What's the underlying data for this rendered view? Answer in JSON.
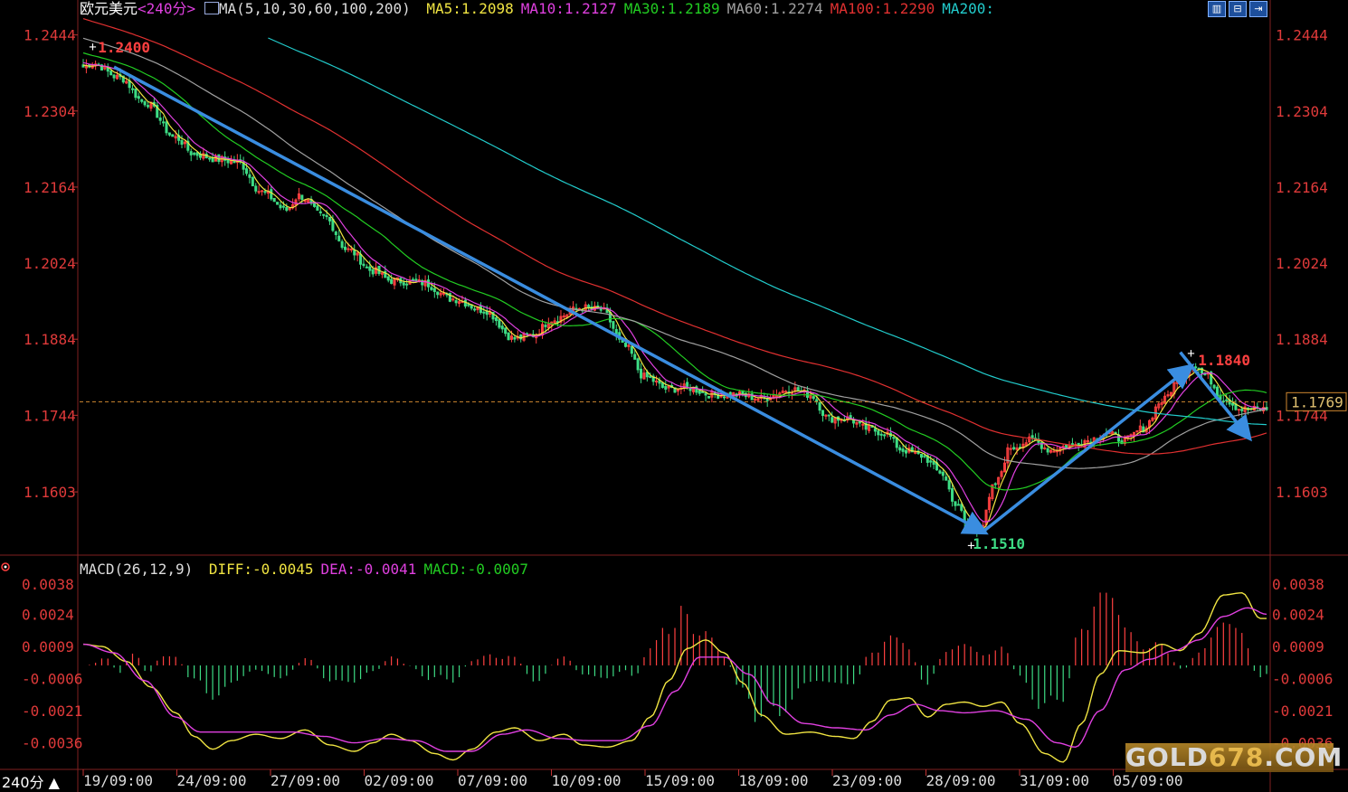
{
  "header": {
    "instrument": "欧元美元",
    "period": "<240分>",
    "ma_label": "MA(5,10,30,60,100,200)",
    "ma_values": [
      {
        "name": "MA5",
        "value": "1.2098",
        "color": "#f0e442"
      },
      {
        "name": "MA10",
        "value": "1.2127",
        "color": "#e040e0"
      },
      {
        "name": "MA30",
        "value": "1.2189",
        "color": "#22cc22"
      },
      {
        "name": "MA60",
        "value": "1.2274",
        "color": "#a0a0a0"
      },
      {
        "name": "MA100",
        "value": "1.2290",
        "color": "#e03030"
      },
      {
        "name": "MA200",
        "value": "",
        "color": "#22cccc"
      }
    ]
  },
  "macd_header": {
    "label": "MACD(26,12,9)",
    "values": [
      {
        "name": "DIFF",
        "value": "-0.0045",
        "color": "#f0e442"
      },
      {
        "name": "DEA",
        "value": "-0.0041",
        "color": "#e040e0"
      },
      {
        "name": "MACD",
        "value": "-0.0007",
        "color": "#22cc22"
      }
    ]
  },
  "toolbar_icons": [
    "chart-icon",
    "fold-icon",
    "exit-icon"
  ],
  "period_tag": "240分 ▲",
  "watermark": {
    "text": "GOLD",
    "number": "678",
    ".com": ".COM"
  },
  "colors": {
    "up": "#ff4040",
    "down": "#3ddc84",
    "axis": "#e03a3a",
    "grid": "#222",
    "arrow": "#3a8de0"
  },
  "chart_data": [
    {
      "type": "candlestick",
      "name": "EURUSD 240min",
      "ylim": [
        1.149,
        1.2475
      ],
      "yticks": [
        1.2444,
        1.2304,
        1.2164,
        1.2024,
        1.1884,
        1.1744,
        1.1603
      ],
      "xticks": [
        "19/09:00",
        "24/09:00",
        "27/09:00",
        "02/09:00",
        "07/09:00",
        "10/09:00",
        "15/09:00",
        "18/09:00",
        "23/09:00",
        "28/09:00",
        "31/09:00",
        "05/09:00"
      ],
      "n_bars": 250,
      "close_anchors": [
        [
          0,
          1.2385
        ],
        [
          3,
          1.2392
        ],
        [
          12,
          1.2365
        ],
        [
          20,
          1.232
        ],
        [
          30,
          1.2255
        ],
        [
          36,
          1.2225
        ],
        [
          44,
          1.2215
        ],
        [
          50,
          1.221
        ],
        [
          58,
          1.2155
        ],
        [
          66,
          1.2122
        ],
        [
          70,
          1.2148
        ],
        [
          78,
          1.211
        ],
        [
          86,
          1.2048
        ],
        [
          94,
          1.201
        ],
        [
          100,
          1.1992
        ],
        [
          110,
          1.1988
        ],
        [
          120,
          1.1958
        ],
        [
          130,
          1.1938
        ],
        [
          140,
          1.1885
        ],
        [
          146,
          1.1892
        ],
        [
          152,
          1.192
        ],
        [
          162,
          1.1942
        ],
        [
          168,
          1.1938
        ],
        [
          176,
          1.187
        ],
        [
          182,
          1.1815
        ],
        [
          190,
          1.1792
        ],
        [
          196,
          1.1795
        ],
        [
          204,
          1.1782
        ],
        [
          212,
          1.1782
        ],
        [
          220,
          1.1775
        ],
        [
          230,
          1.1792
        ],
        [
          236,
          1.1782
        ],
        [
          242,
          1.1738
        ],
        [
          248,
          1.1738
        ],
        [
          254,
          1.172
        ],
        [
          260,
          1.1712
        ],
        [
          266,
          1.168
        ],
        [
          272,
          1.167
        ],
        [
          278,
          1.164
        ],
        [
          284,
          1.1575
        ],
        [
          287,
          1.1538
        ],
        [
          291,
          1.1535
        ],
        [
          296,
          1.1618
        ],
        [
          301,
          1.1685
        ],
        [
          308,
          1.1698
        ],
        [
          314,
          1.168
        ],
        [
          320,
          1.1688
        ],
        [
          326,
          1.1698
        ],
        [
          332,
          1.171
        ],
        [
          338,
          1.1698
        ],
        [
          344,
          1.172
        ],
        [
          350,
          1.177
        ],
        [
          356,
          1.1812
        ],
        [
          360,
          1.1838
        ],
        [
          364,
          1.1818
        ],
        [
          370,
          1.1775
        ],
        [
          376,
          1.1755
        ]
      ],
      "high_label": "1.2400",
      "low_label": "1.1510",
      "swing_label": "1.1840",
      "last_price": "1.1769",
      "last_value": 1.1769,
      "moving_averages": [
        {
          "name": "MA5",
          "period": 5,
          "color": "#f0e442"
        },
        {
          "name": "MA10",
          "period": 10,
          "color": "#e040e0"
        },
        {
          "name": "MA30",
          "period": 30,
          "color": "#22cc22"
        },
        {
          "name": "MA60",
          "period": 60,
          "color": "#a0a0a0"
        },
        {
          "name": "MA100",
          "period": 100,
          "color": "#e03030"
        },
        {
          "name": "MA200",
          "period": 200,
          "color": "#22cccc"
        }
      ],
      "trend_arrows": [
        {
          "from": [
            10,
            1.2385
          ],
          "to": [
            292,
            1.153
          ]
        },
        {
          "from": [
            292,
            1.153
          ],
          "to": [
            359,
            1.1832
          ]
        },
        {
          "from": [
            356,
            1.186
          ],
          "to": [
            378,
            1.1705
          ]
        }
      ]
    },
    {
      "type": "macd",
      "ylim": [
        -0.0048,
        0.0044
      ],
      "yticks": [
        0.0038,
        0.0024,
        0.0009,
        -0.0006,
        -0.0021,
        -0.0036
      ],
      "diff": [
        [
          0,
          0.001
        ],
        [
          6,
          0.0009
        ],
        [
          14,
          0.0002
        ],
        [
          22,
          -0.001
        ],
        [
          30,
          -0.0022
        ],
        [
          36,
          -0.0033
        ],
        [
          42,
          -0.0039
        ],
        [
          48,
          -0.0035
        ],
        [
          56,
          -0.0032
        ],
        [
          64,
          -0.0034
        ],
        [
          72,
          -0.003
        ],
        [
          80,
          -0.0037
        ],
        [
          88,
          -0.004
        ],
        [
          94,
          -0.0036
        ],
        [
          100,
          -0.0032
        ],
        [
          106,
          -0.0035
        ],
        [
          114,
          -0.0041
        ],
        [
          120,
          -0.0044
        ],
        [
          126,
          -0.0039
        ],
        [
          134,
          -0.0031
        ],
        [
          140,
          -0.0029
        ],
        [
          148,
          -0.0035
        ],
        [
          156,
          -0.0032
        ],
        [
          162,
          -0.0037
        ],
        [
          170,
          -0.0038
        ],
        [
          178,
          -0.0035
        ],
        [
          184,
          -0.0024
        ],
        [
          190,
          -0.0007
        ],
        [
          196,
          0.0008
        ],
        [
          202,
          0.0012
        ],
        [
          208,
          0.0006
        ],
        [
          214,
          -0.0008
        ],
        [
          220,
          -0.0023
        ],
        [
          228,
          -0.0032
        ],
        [
          236,
          -0.0031
        ],
        [
          244,
          -0.0033
        ],
        [
          250,
          -0.0034
        ],
        [
          256,
          -0.0026
        ],
        [
          262,
          -0.0016
        ],
        [
          268,
          -0.0015
        ],
        [
          274,
          -0.0024
        ],
        [
          280,
          -0.0018
        ],
        [
          286,
          -0.0017
        ],
        [
          292,
          -0.0019
        ],
        [
          298,
          -0.0017
        ],
        [
          304,
          -0.0027
        ],
        [
          312,
          -0.0041
        ],
        [
          318,
          -0.0045
        ],
        [
          324,
          -0.0027
        ],
        [
          330,
          -0.0004
        ],
        [
          336,
          0.0007
        ],
        [
          344,
          0.0006
        ],
        [
          350,
          0.001
        ],
        [
          356,
          0.0007
        ],
        [
          362,
          0.0015
        ],
        [
          370,
          0.0033
        ],
        [
          376,
          0.0034
        ],
        [
          382,
          0.0022
        ]
      ],
      "dea": [
        [
          0,
          0.001
        ],
        [
          10,
          0.0006
        ],
        [
          20,
          -0.0007
        ],
        [
          30,
          -0.0024
        ],
        [
          38,
          -0.0031
        ],
        [
          48,
          -0.0031
        ],
        [
          58,
          -0.0031
        ],
        [
          68,
          -0.0031
        ],
        [
          78,
          -0.0033
        ],
        [
          88,
          -0.0036
        ],
        [
          98,
          -0.0034
        ],
        [
          108,
          -0.0035
        ],
        [
          118,
          -0.004
        ],
        [
          126,
          -0.004
        ],
        [
          136,
          -0.0032
        ],
        [
          144,
          -0.003
        ],
        [
          154,
          -0.0034
        ],
        [
          164,
          -0.0035
        ],
        [
          174,
          -0.0035
        ],
        [
          184,
          -0.0028
        ],
        [
          192,
          -0.0012
        ],
        [
          200,
          0.0004
        ],
        [
          208,
          0.0004
        ],
        [
          216,
          -0.0004
        ],
        [
          224,
          -0.0018
        ],
        [
          234,
          -0.0027
        ],
        [
          244,
          -0.0029
        ],
        [
          254,
          -0.003
        ],
        [
          262,
          -0.0023
        ],
        [
          270,
          -0.0018
        ],
        [
          278,
          -0.0021
        ],
        [
          286,
          -0.0022
        ],
        [
          296,
          -0.0021
        ],
        [
          306,
          -0.0025
        ],
        [
          316,
          -0.0036
        ],
        [
          322,
          -0.0038
        ],
        [
          330,
          -0.0021
        ],
        [
          338,
          -0.0002
        ],
        [
          346,
          0.0003
        ],
        [
          354,
          0.0007
        ],
        [
          362,
          0.0012
        ],
        [
          370,
          0.0023
        ],
        [
          378,
          0.0027
        ],
        [
          384,
          0.0024
        ]
      ]
    }
  ]
}
